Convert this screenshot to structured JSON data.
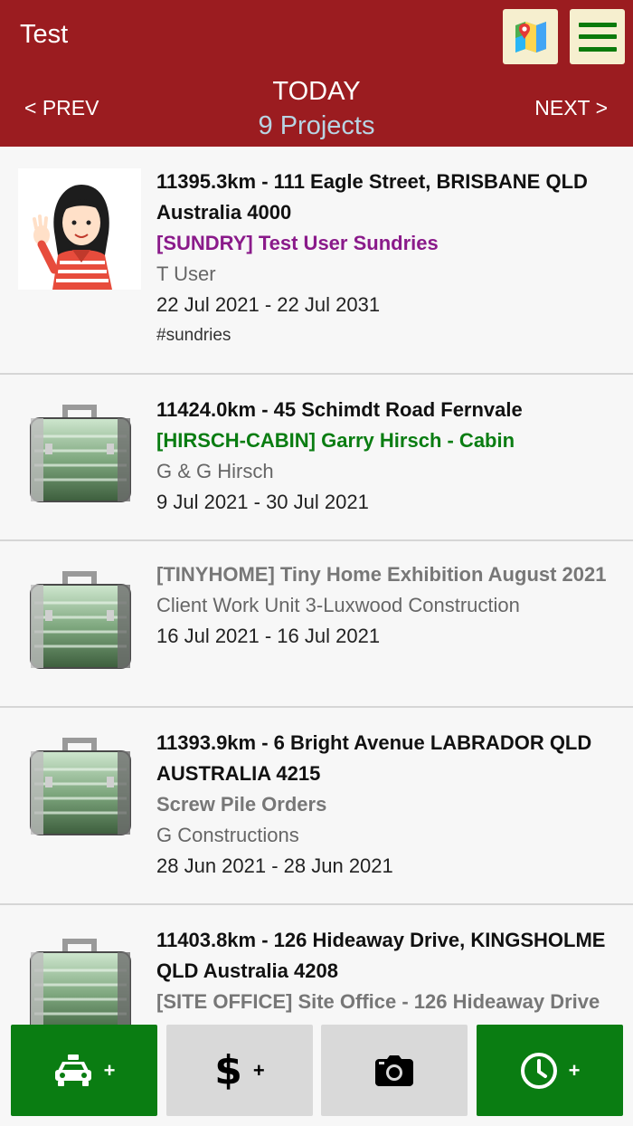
{
  "header": {
    "title": "Test",
    "map_icon": "map-icon",
    "menu_icon": "hamburger-menu-icon",
    "nav": {
      "prev": "< PREV",
      "today": "TODAY",
      "count": "9 Projects",
      "next": "NEXT >"
    }
  },
  "colors": {
    "header_bg": "#9b1c20",
    "accent_green": "#0a7d12",
    "sundry_purple": "#8a1a8a",
    "project_green": "#0a7d12",
    "muted_grey": "#777777"
  },
  "projects": [
    {
      "thumb": "avatar-waving-woman",
      "address": "11395.3km - 111 Eagle Street, BRISBANE QLD Australia 4000",
      "job": "[SUNDRY] Test User Sundries",
      "client": "T User",
      "dates": "22 Jul 2021 - 22 Jul 2031",
      "tag": "#sundries"
    },
    {
      "thumb": "briefcase-icon",
      "address": "11424.0km - 45 Schimdt Road Fernvale",
      "job": "[HIRSCH-CABIN] Garry Hirsch - Cabin",
      "client": "G & G Hirsch",
      "dates": "9 Jul 2021 - 30 Jul 2021"
    },
    {
      "thumb": "briefcase-icon",
      "job": "[TINYHOME] Tiny Home Exhibition August 2021",
      "client": "Client Work Unit 3-Luxwood Construction",
      "dates": "16 Jul 2021 - 16 Jul 2021"
    },
    {
      "thumb": "briefcase-icon",
      "address": "11393.9km - 6 Bright Avenue LABRADOR QLD AUSTRALIA 4215",
      "job": "Screw Pile Orders",
      "client": "G Constructions",
      "dates": "28 Jun 2021 - 28 Jun 2021"
    },
    {
      "thumb": "briefcase-icon",
      "address": "11403.8km - 126 Hideaway Drive, KINGSHOLME QLD Australia 4208",
      "job": "[SITE OFFICE] Site Office - 126 Hideaway Drive"
    }
  ],
  "toolbar": {
    "taxi": {
      "icon": "taxi-icon",
      "plus": "+"
    },
    "expense": {
      "icon": "dollar-icon",
      "plus": "+"
    },
    "camera": {
      "icon": "camera-icon"
    },
    "time": {
      "icon": "clock-icon",
      "plus": "+"
    }
  }
}
